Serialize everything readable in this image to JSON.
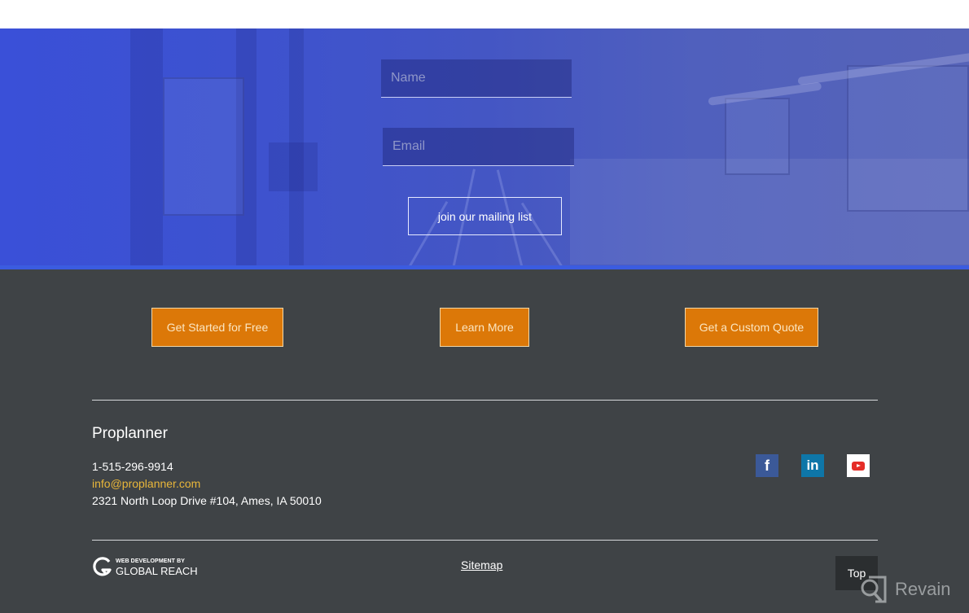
{
  "signup": {
    "name_placeholder": "Name",
    "email_placeholder": "Email",
    "submit_label": "join our mailing list"
  },
  "cta_buttons": [
    {
      "label": "Get Started for Free"
    },
    {
      "label": "Learn More"
    },
    {
      "label": "Get a Custom Quote"
    }
  ],
  "footer": {
    "company_name": "Proplanner",
    "phone": "1-515-296-9914",
    "email": "info@proplanner.com",
    "address": "2321 North Loop Drive #104, Ames, IA 50010",
    "social": [
      {
        "name": "facebook",
        "glyph": "f",
        "color": "#3b5998"
      },
      {
        "name": "linkedin",
        "glyph": "in",
        "color": "#0e76a8"
      },
      {
        "name": "youtube",
        "glyph": "",
        "color": "#e52d27"
      }
    ],
    "credit_small": "WEB DEVELOPMENT BY",
    "credit_big": "GLOBAL REACH",
    "sitemap_label": "Sitemap",
    "top_label": "Top"
  },
  "watermark": {
    "label": "Revain"
  },
  "colors": {
    "hero_blue": "#3a50d8",
    "cta_orange": "#dc7808",
    "footer_bg": "#3f4346",
    "email_link": "#e8b63a"
  }
}
